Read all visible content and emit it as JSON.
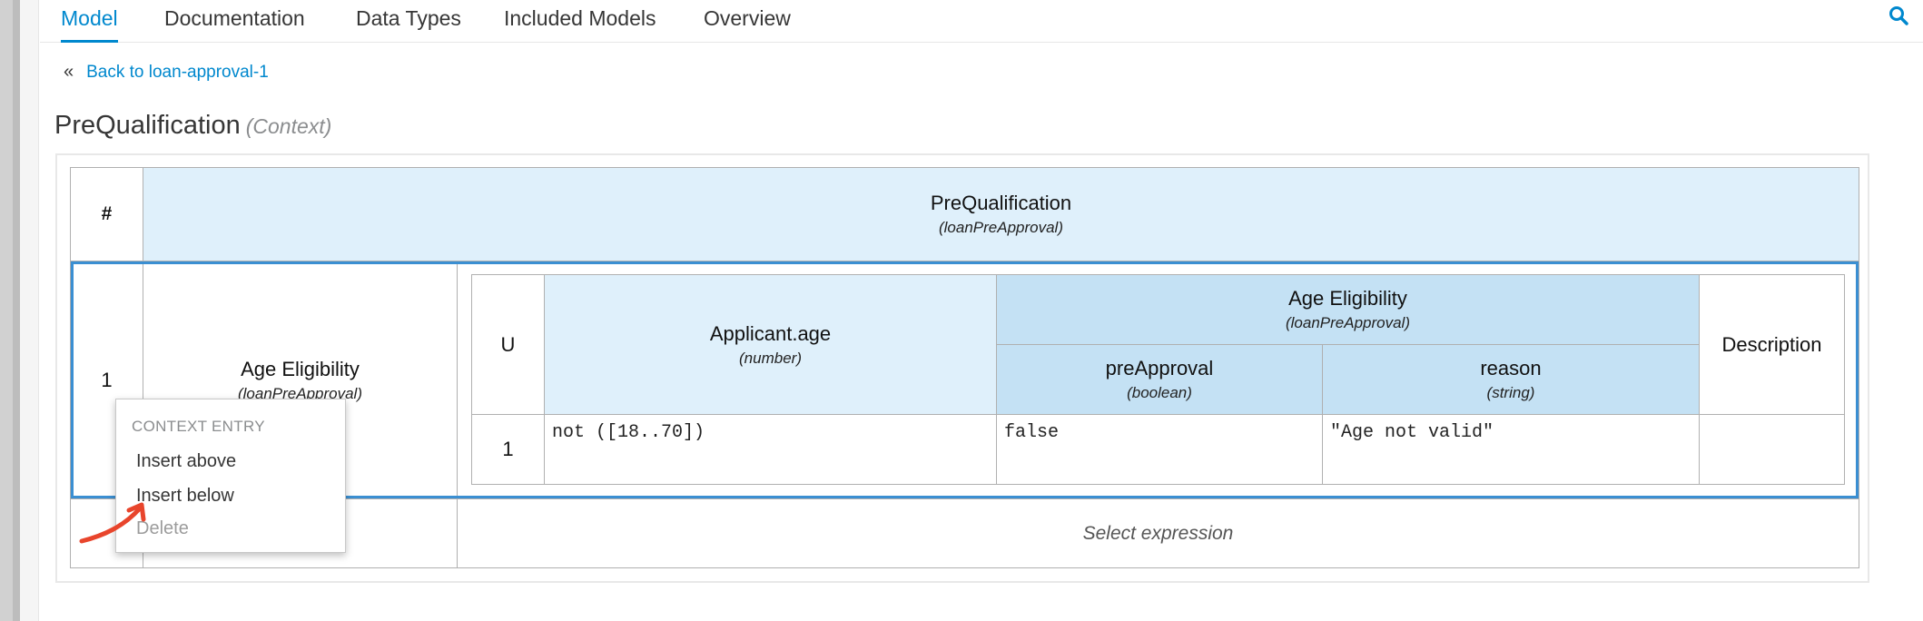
{
  "tabs": [
    "Model",
    "Documentation",
    "Data Types",
    "Included Models",
    "Overview"
  ],
  "back_link": "Back to loan-approval-1",
  "back_chevron": "«",
  "title": {
    "name": "PreQualification",
    "kind": "(Context)"
  },
  "context": {
    "index_header": "#",
    "header": {
      "name": "PreQualification",
      "type": "(loanPreApproval)"
    },
    "rows": [
      {
        "index": "1",
        "name": "Age Eligibility",
        "type": "(loanPreApproval)"
      }
    ],
    "result_placeholder": "Select expression"
  },
  "decision_table": {
    "hit_policy": "U",
    "input": {
      "name": "Applicant.age",
      "type": "(number)"
    },
    "output_group": {
      "name": "Age Eligibility",
      "type": "(loanPreApproval)"
    },
    "outputs": [
      {
        "name": "preApproval",
        "type": "(boolean)"
      },
      {
        "name": "reason",
        "type": "(string)"
      }
    ],
    "description_header": "Description",
    "rules": [
      {
        "index": "1",
        "input": "not ([18..70])",
        "preApproval": "false",
        "reason": "\"Age not valid\"",
        "description": ""
      }
    ]
  },
  "context_menu": {
    "header": "CONTEXT ENTRY",
    "items": [
      "Insert above",
      "Insert below",
      "Delete"
    ],
    "disabled": [
      "Delete"
    ]
  },
  "colors": {
    "accent": "#0088ce",
    "header_light": "#dff0fb",
    "header_mid": "#c4e1f4",
    "selection": "#3b8fd2",
    "annotation": "#e8452c"
  },
  "icons": [
    "search-icon",
    "double-chevron-left-icon",
    "annotation-arrow-icon"
  ]
}
